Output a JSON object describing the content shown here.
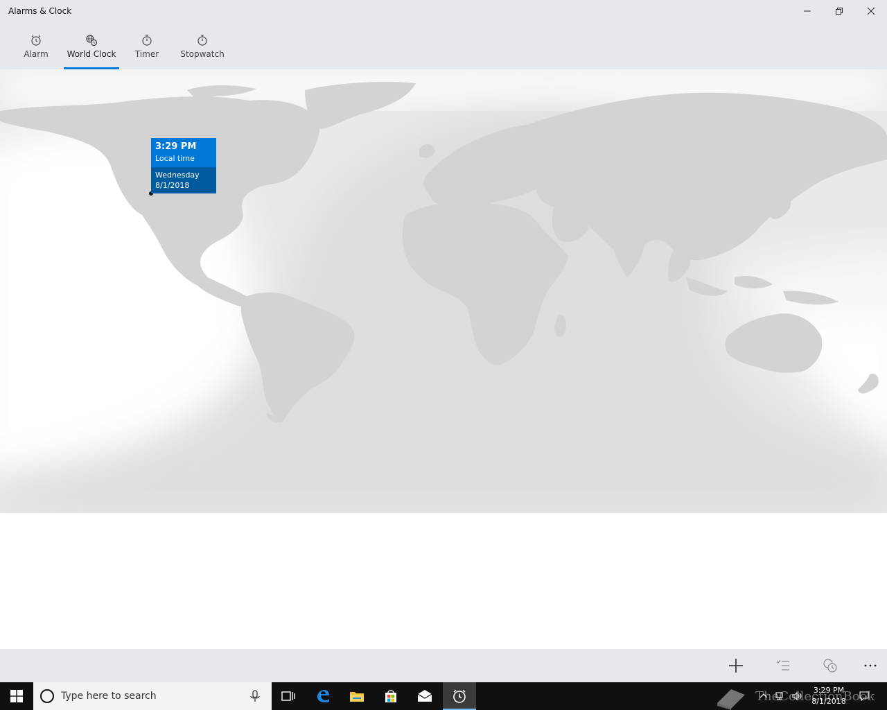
{
  "window": {
    "title": "Alarms & Clock",
    "controls": {
      "minimize_icon": "minimize-icon",
      "restore_icon": "restore-icon",
      "close_icon": "close-icon"
    }
  },
  "tabs": [
    {
      "label": "Alarm",
      "icon": "alarm-icon",
      "active": false
    },
    {
      "label": "World Clock",
      "icon": "world-clock-icon",
      "active": true
    },
    {
      "label": "Timer",
      "icon": "timer-icon",
      "active": false
    },
    {
      "label": "Stopwatch",
      "icon": "stopwatch-icon",
      "active": false
    }
  ],
  "map": {
    "local_time_card": {
      "time": "3:29 PM",
      "label": "Local time",
      "day": "Wednesday",
      "date": "8/1/2018"
    }
  },
  "command_bar": [
    {
      "name": "add-button",
      "icon": "plus-icon"
    },
    {
      "name": "select-button",
      "icon": "checklist-icon"
    },
    {
      "name": "compare-button",
      "icon": "compare-clock-icon"
    },
    {
      "name": "more-button",
      "icon": "more-icon"
    }
  ],
  "taskbar": {
    "search_placeholder": "Type here to search",
    "apps": [
      {
        "name": "task-view",
        "icon": "task-view-icon"
      },
      {
        "name": "edge",
        "icon": "edge-icon"
      },
      {
        "name": "file-explorer",
        "icon": "folder-icon"
      },
      {
        "name": "store",
        "icon": "store-icon"
      },
      {
        "name": "mail",
        "icon": "mail-icon"
      },
      {
        "name": "alarms-clock",
        "icon": "alarm-clock-icon",
        "active": true
      }
    ],
    "clock": {
      "time": "3:29 PM",
      "date": "8/1/2018"
    },
    "watermark": "TheCollectionBook"
  },
  "colors": {
    "accent": "#0078d7",
    "accent_dark": "#005a9e",
    "chrome_bg": "#e5e9ee",
    "land": "#d6d6d6",
    "night_shade": "#c6c6c6"
  }
}
